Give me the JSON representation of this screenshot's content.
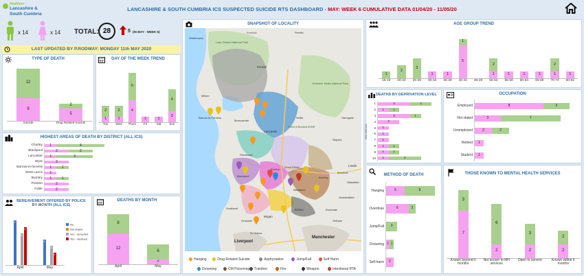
{
  "header": {
    "logo_line1": "Healthier",
    "logo_line2": "Lancashire &",
    "logo_line3": "South Cumbria",
    "title_a": "LANCASHIRE & SOUTH CUMBRIA ICS SUSPECTED SUICIDE RTS DASHBOARD - ",
    "title_b": "MAY: WEEK 6 CUMULATIVE DATA 01/04/20 - 11/05/20",
    "colors": {
      "title_a": "#2f6aa0",
      "title_b": "#c0001a"
    }
  },
  "kpi": {
    "male_count": "x 14",
    "female_count": "x 14",
    "total_label": "TOTAL:",
    "total": "28",
    "increase": "5",
    "increase_note": "(IN MAY - WEEK 6)"
  },
  "updated": {
    "text": "LAST UPDATED BY P.RODWAY: MONDAY 11th MAY 2020"
  },
  "panels": {
    "type_of_death": "TYPE OF DEATH",
    "day_of_week": "DAY OF THE WEEK TREND",
    "district": "HIGHEST AREAS OF DEATH BY DISTRICT (ALL ICS)",
    "bereavement": "BEREAVEMENT OFFERED BY POLICE BY MONTH (ALL ICS)",
    "deaths_by_month": "DEATHS BY MONTH",
    "map": "SNAPSHOT OF LOCALITY",
    "age": "AGE GROUP TREND",
    "deprivation": "DEATHS BY DEPRIVATION LEVEL",
    "occupation": "OCCUPATION",
    "method": "METHOD OF DEATH",
    "mental_health": "THOSE KNOWN TO MENTAL HEALTH SERVICES"
  },
  "type_of_death": {
    "categories": [
      "Suicide",
      "Drug Related Suicide"
    ],
    "pink": [
      9,
      5
    ],
    "green": [
      12,
      2
    ]
  },
  "day_of_week": {
    "categories": [
      "Tue",
      "Wed",
      "Thurs",
      "Fri",
      "Sat",
      "Sun"
    ],
    "pink": [
      1,
      1,
      4,
      1,
      1,
      2
    ],
    "green": [
      2,
      2,
      5,
      0,
      0,
      4
    ]
  },
  "district": {
    "categories": [
      "Chorley",
      "Blackpool",
      "Lancaster",
      "Wyre",
      "Barrow-in-furness",
      "West Lancs",
      "Burnley",
      "Preston",
      "Fylde"
    ],
    "pink": [
      1,
      2,
      1,
      2,
      1,
      1,
      1,
      2,
      2
    ],
    "green": [
      4,
      2,
      3,
      0,
      1,
      0,
      1,
      0,
      0
    ]
  },
  "bereavement": {
    "months": [
      "April",
      "May"
    ],
    "legend": [
      "No",
      "Not stated",
      "Yes - accepted",
      "Yes - declined"
    ],
    "legend_colors": [
      "#4472c4",
      "#ed7d31",
      "#a5a5a5",
      "#c00000"
    ],
    "values": [
      [
        7,
        0,
        5,
        6
      ],
      [
        4,
        0,
        3,
        2
      ]
    ]
  },
  "deaths_by_month": {
    "categories": [
      "April",
      "May"
    ],
    "pink": [
      12,
      2
    ],
    "green": [
      8,
      6
    ]
  },
  "map": {
    "places": [
      "Keswick",
      "Lake District National Park",
      "Kendal",
      "Yorkshire Dales National Park",
      "Millom",
      "Barrow-in-Furness",
      "Morecambe",
      "Lancaster",
      "Settle",
      "Fleetwood",
      "Blackpool",
      "Preston",
      "Blackburn",
      "Burnley",
      "Southport",
      "Wigan",
      "Bolton",
      "St Helens",
      "Liverpool",
      "Manchester",
      "Forest of Bowland AONB",
      "Harrogate",
      "Skipton",
      "Leeds",
      "Bradford",
      "Wakefield",
      "Huddersfield",
      "Rochdale",
      "Oldham",
      "Ormskirk",
      "Whitehaven",
      "Penrith",
      "Great Britain"
    ],
    "legend": [
      "Hanging",
      "Drug Related Suicide",
      "Asphyxiation",
      "Jump/Fall",
      "Self Harm",
      "Drowning",
      "CM Poisoning",
      "Trainline",
      "Fire",
      "Weapon",
      "Intentional RTA"
    ]
  },
  "age": {
    "categories": [
      "15-19",
      "20-24",
      "25-29",
      "30-34",
      "35-39",
      "40-44",
      "45-49",
      "50-54",
      "55-59",
      "60-64",
      "65-69",
      "70-74",
      "80-84"
    ],
    "pink": [
      0,
      0,
      0,
      1,
      1,
      5,
      0,
      1,
      1,
      1,
      1,
      1,
      1
    ],
    "green": [
      1,
      2,
      3,
      0,
      0,
      1,
      0,
      2,
      0,
      0,
      0,
      2,
      0
    ]
  },
  "deprivation": {
    "axis": "IMD DECILE",
    "categories": [
      "1",
      "2",
      "3",
      "4",
      "5",
      "6",
      "7",
      "8",
      "9",
      "10"
    ],
    "pink": [
      3,
      1,
      3,
      2,
      1,
      1,
      1,
      1,
      1,
      1
    ],
    "green": [
      2,
      1,
      1,
      0,
      0,
      0,
      0,
      1,
      1,
      3
    ]
  },
  "occupation": {
    "categories": [
      "Employed",
      "Not stated",
      "Unemployed",
      "Retired",
      "Student"
    ],
    "pink": [
      8,
      3,
      2,
      1,
      1
    ],
    "green": [
      3,
      7,
      2,
      0,
      0
    ]
  },
  "method": {
    "categories": [
      "Hanging",
      "Overdose",
      "Jump/Fall",
      "Drowning",
      "Self-harm"
    ],
    "pink": [
      5,
      6,
      0,
      1,
      2
    ],
    "green": [
      8,
      2,
      3,
      1,
      0
    ]
  },
  "mental_health": {
    "categories": [
      "Known beyond 6 months",
      "Not known to MH services",
      "Open to service",
      "Known within 6 months"
    ],
    "pink": [
      7,
      2,
      2,
      2
    ],
    "green": [
      3,
      6,
      3,
      2
    ]
  }
}
